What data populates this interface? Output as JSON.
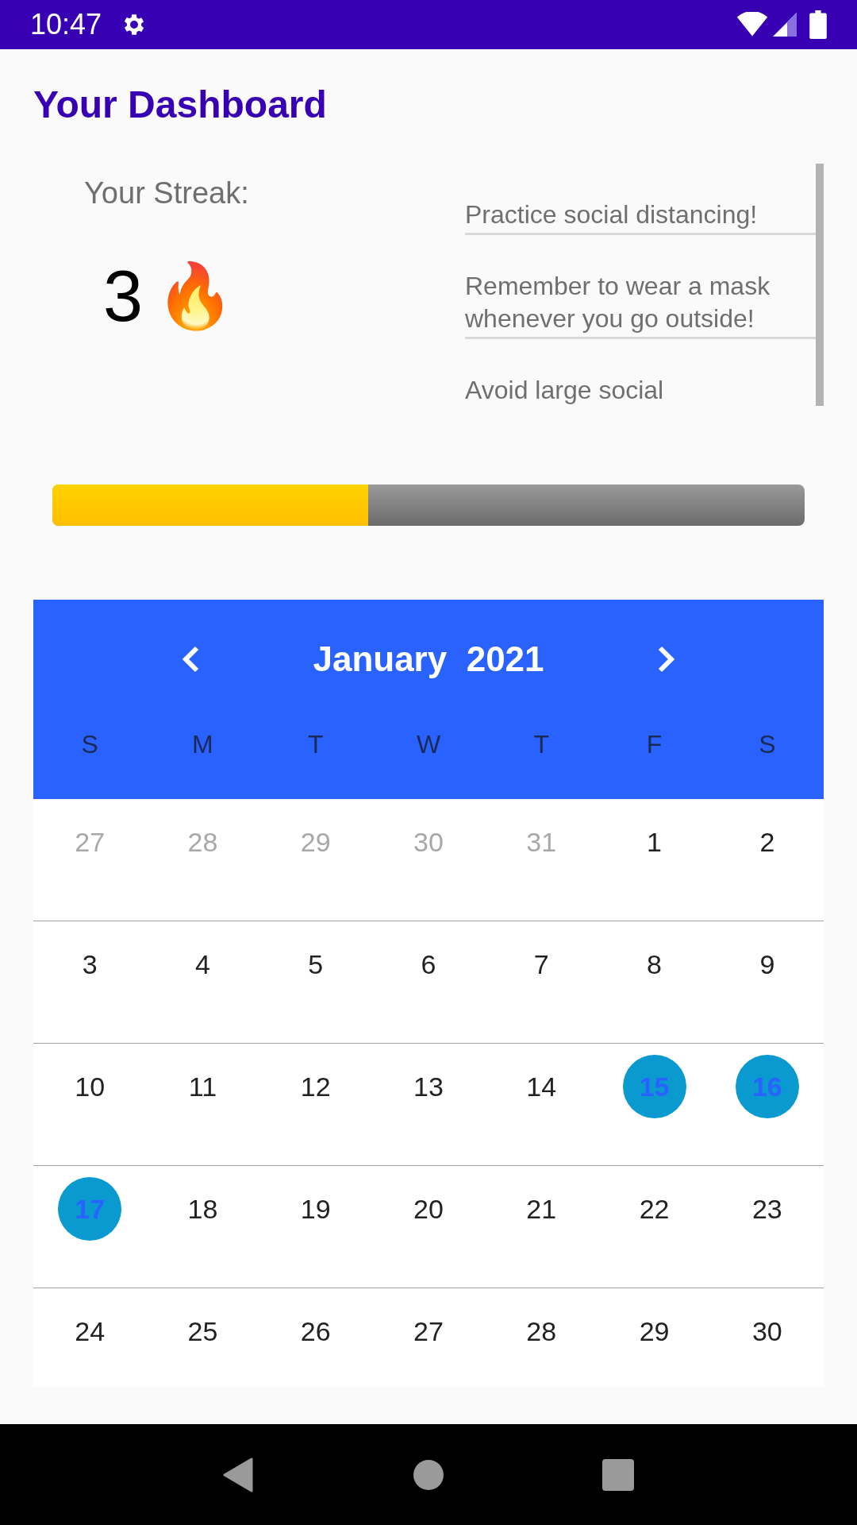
{
  "status_bar": {
    "time": "10:47"
  },
  "title": "Your Dashboard",
  "streak": {
    "label": "Your Streak:",
    "count": "3",
    "emoji": "🔥"
  },
  "tips": [
    "Practice social distancing!",
    "Remember to wear a mask whenever you go outside!",
    "Avoid large social"
  ],
  "progress": {
    "level": 0.42
  },
  "calendar": {
    "month": "January  2021",
    "weekdays": [
      "S",
      "M",
      "T",
      "W",
      "T",
      "F",
      "S"
    ],
    "days": [
      {
        "label": "27",
        "muted": true,
        "selected": false
      },
      {
        "label": "28",
        "muted": true,
        "selected": false
      },
      {
        "label": "29",
        "muted": true,
        "selected": false
      },
      {
        "label": "30",
        "muted": true,
        "selected": false
      },
      {
        "label": "31",
        "muted": true,
        "selected": false
      },
      {
        "label": "1",
        "muted": false,
        "selected": false
      },
      {
        "label": "2",
        "muted": false,
        "selected": false
      },
      {
        "label": "3",
        "muted": false,
        "selected": false
      },
      {
        "label": "4",
        "muted": false,
        "selected": false
      },
      {
        "label": "5",
        "muted": false,
        "selected": false
      },
      {
        "label": "6",
        "muted": false,
        "selected": false
      },
      {
        "label": "7",
        "muted": false,
        "selected": false
      },
      {
        "label": "8",
        "muted": false,
        "selected": false
      },
      {
        "label": "9",
        "muted": false,
        "selected": false
      },
      {
        "label": "10",
        "muted": false,
        "selected": false
      },
      {
        "label": "11",
        "muted": false,
        "selected": false
      },
      {
        "label": "12",
        "muted": false,
        "selected": false
      },
      {
        "label": "13",
        "muted": false,
        "selected": false
      },
      {
        "label": "14",
        "muted": false,
        "selected": false
      },
      {
        "label": "15",
        "muted": false,
        "selected": true
      },
      {
        "label": "16",
        "muted": false,
        "selected": true
      },
      {
        "label": "17",
        "muted": false,
        "selected": true
      },
      {
        "label": "18",
        "muted": false,
        "selected": false
      },
      {
        "label": "19",
        "muted": false,
        "selected": false
      },
      {
        "label": "20",
        "muted": false,
        "selected": false
      },
      {
        "label": "21",
        "muted": false,
        "selected": false
      },
      {
        "label": "22",
        "muted": false,
        "selected": false
      },
      {
        "label": "23",
        "muted": false,
        "selected": false
      },
      {
        "label": "24",
        "muted": false,
        "selected": false
      },
      {
        "label": "25",
        "muted": false,
        "selected": false
      },
      {
        "label": "26",
        "muted": false,
        "selected": false
      },
      {
        "label": "27",
        "muted": false,
        "selected": false
      },
      {
        "label": "28",
        "muted": false,
        "selected": false
      },
      {
        "label": "29",
        "muted": false,
        "selected": false
      },
      {
        "label": "30",
        "muted": false,
        "selected": false
      }
    ]
  }
}
